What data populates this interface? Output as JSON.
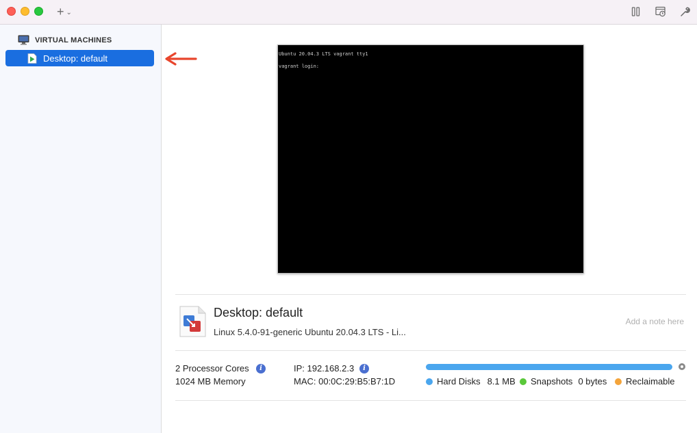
{
  "titlebar": {
    "add_icon": "plus-icon",
    "chevron_icon": "chevron-down-icon",
    "suspend_icon": "pause-icon",
    "snapshot_icon": "snapshot-icon",
    "settings_icon": "wrench-icon"
  },
  "sidebar": {
    "header_label": "VIRTUAL MACHINES",
    "items": [
      {
        "label": "Desktop: default",
        "selected": true
      }
    ]
  },
  "console": {
    "lines": [
      "Ubuntu 20.04.3 LTS vagrant tty1",
      "vagrant login:"
    ]
  },
  "vm_info": {
    "name": "Desktop: default",
    "os": "Linux 5.4.0-91-generic Ubuntu 20.04.3 LTS - Li...",
    "note_placeholder": "Add a note here"
  },
  "stats": {
    "cpu": "2 Processor Cores",
    "memory": "1024 MB Memory",
    "ip": "IP: 192.168.2.3",
    "mac": "MAC: 00:0C:29:B5:B7:1D"
  },
  "storage": {
    "hard_disks_label": "Hard Disks",
    "hard_disks_value": "8.1 MB",
    "snapshots_label": "Snapshots",
    "snapshots_value": "0 bytes",
    "reclaimable_label": "Reclaimable",
    "colors": {
      "hard_disks": "#4aa6ee",
      "snapshots": "#5ac83a",
      "reclaimable": "#f4a43a"
    }
  },
  "colors": {
    "accent": "#1a6ee0",
    "arrow": "#e8452c"
  }
}
